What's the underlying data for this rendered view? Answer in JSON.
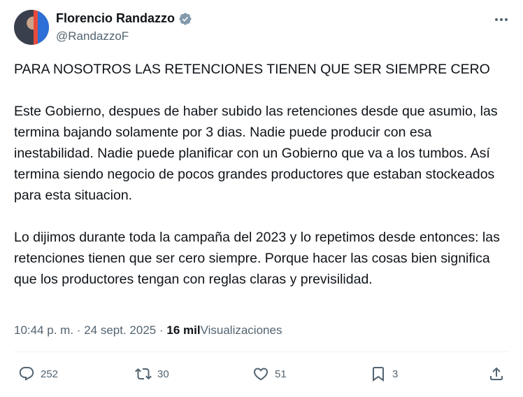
{
  "author": {
    "name": "Florencio Randazzo",
    "handle": "@RandazzoF"
  },
  "tweet": {
    "p1": "PARA NOSOTROS LAS RETENCIONES TIENEN QUE SER SIEMPRE CERO",
    "p2": "Este Gobierno, despues de haber subido las retenciones desde que asumio, las termina bajando solamente por 3 dias. Nadie puede producir con esa inestabilidad.  Nadie puede planificar con un Gobierno que va a los tumbos. Así termina siendo negocio de pocos grandes productores que estaban stockeados para esta situacion.",
    "p3": "Lo dijimos durante toda la campaña del 2023 y lo repetimos desde entonces: las retenciones tienen que ser cero siempre. Porque hacer las cosas bien significa que los productores tengan con reglas claras y previsilidad."
  },
  "meta": {
    "time": "10:44 p. m.",
    "sep1": "·",
    "date": "24 sept. 2025",
    "sep2": "·",
    "views_count": "16 mil",
    "views_label": "Visualizaciones"
  },
  "actions": {
    "replies": "252",
    "reposts": "30",
    "likes": "51",
    "bookmarks": "3"
  },
  "colors": {
    "verified": "#829aab",
    "secondary_text": "#536471"
  },
  "icons": [
    "verified-badge-icon",
    "more-icon",
    "reply-icon",
    "repost-icon",
    "like-icon",
    "bookmark-icon",
    "share-icon"
  ]
}
